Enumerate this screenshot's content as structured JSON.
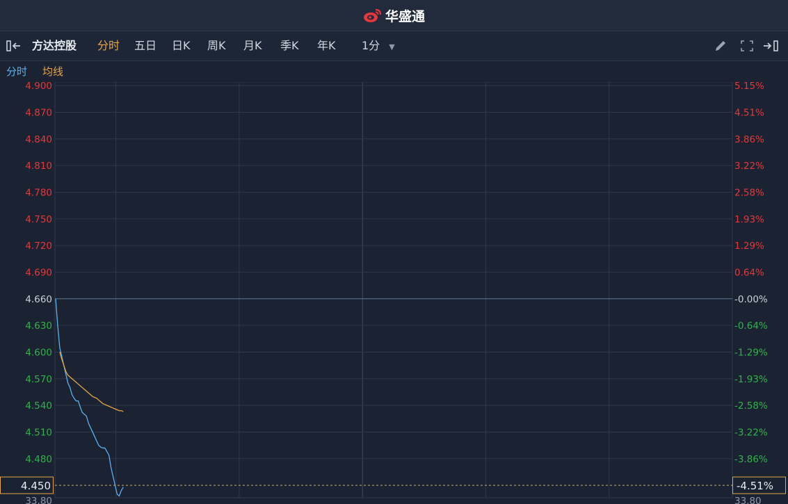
{
  "app": {
    "title": "华盛通"
  },
  "toolbar": {
    "stock_name": "方达控股",
    "tabs": [
      "分时",
      "五日",
      "日K",
      "周K",
      "月K",
      "季K",
      "年K"
    ],
    "active_tab": "分时",
    "interval": "1分"
  },
  "legend": {
    "time_label": "分时",
    "avg_label": "均线"
  },
  "colors": {
    "background": "#1b2332",
    "up": "#e5373d",
    "down": "#2fb34a",
    "price_line": "#5bb2f0",
    "avg_line": "#e7a642",
    "marker": "#e7a642",
    "grid": "#2c384b"
  },
  "chart_data": {
    "type": "line",
    "y_ticks": [
      "4.900",
      "4.870",
      "4.840",
      "4.810",
      "4.780",
      "4.750",
      "4.720",
      "4.690",
      "4.660",
      "4.630",
      "4.600",
      "4.570",
      "4.540",
      "4.510",
      "4.480"
    ],
    "pct_ticks": [
      "5.15%",
      "4.51%",
      "3.86%",
      "3.22%",
      "2.58%",
      "1.93%",
      "1.29%",
      "0.64%",
      "-0.00%",
      "-0.64%",
      "-1.29%",
      "-1.93%",
      "-2.58%",
      "-3.22%",
      "-3.86%"
    ],
    "ylim": [
      4.436,
      4.904
    ],
    "prev_close": 4.66,
    "current_price": "4.450",
    "current_pct": "-4.51%",
    "volume_left_label": "33.80",
    "volume_right_label": "33.80",
    "total_minutes": 330,
    "series": [
      {
        "name": "分时",
        "x": [
          0,
          1,
          2,
          3,
          4,
          5,
          6,
          7,
          8,
          9,
          10,
          11,
          12,
          13,
          14,
          15,
          16,
          17,
          18,
          19,
          20,
          21,
          22,
          23,
          24,
          25,
          26,
          27,
          28,
          29,
          30,
          31,
          32,
          33
        ],
        "values": [
          4.66,
          4.63,
          4.605,
          4.595,
          4.585,
          4.575,
          4.565,
          4.56,
          4.552,
          4.548,
          4.545,
          4.545,
          4.538,
          4.532,
          4.53,
          4.528,
          4.52,
          4.515,
          4.51,
          4.505,
          4.5,
          4.495,
          4.493,
          4.492,
          4.492,
          4.488,
          4.484,
          4.47,
          4.46,
          4.45,
          4.44,
          4.438,
          4.444,
          4.448
        ]
      },
      {
        "name": "均线",
        "x": [
          0,
          1,
          2,
          3,
          4,
          5,
          6,
          7,
          8,
          9,
          10,
          11,
          12,
          13,
          14,
          15,
          16,
          17,
          18,
          19,
          20,
          21,
          22,
          23,
          24,
          25,
          26,
          27,
          28,
          29,
          30,
          31,
          32,
          33
        ],
        "values": [
          4.61,
          4.605,
          4.6,
          4.592,
          4.585,
          4.578,
          4.574,
          4.572,
          4.57,
          4.568,
          4.566,
          4.564,
          4.562,
          4.56,
          4.558,
          4.556,
          4.554,
          4.552,
          4.55,
          4.549,
          4.548,
          4.546,
          4.544,
          4.542,
          4.541,
          4.54,
          4.539,
          4.538,
          4.537,
          4.536,
          4.535,
          4.534,
          4.534,
          4.533
        ]
      }
    ]
  }
}
